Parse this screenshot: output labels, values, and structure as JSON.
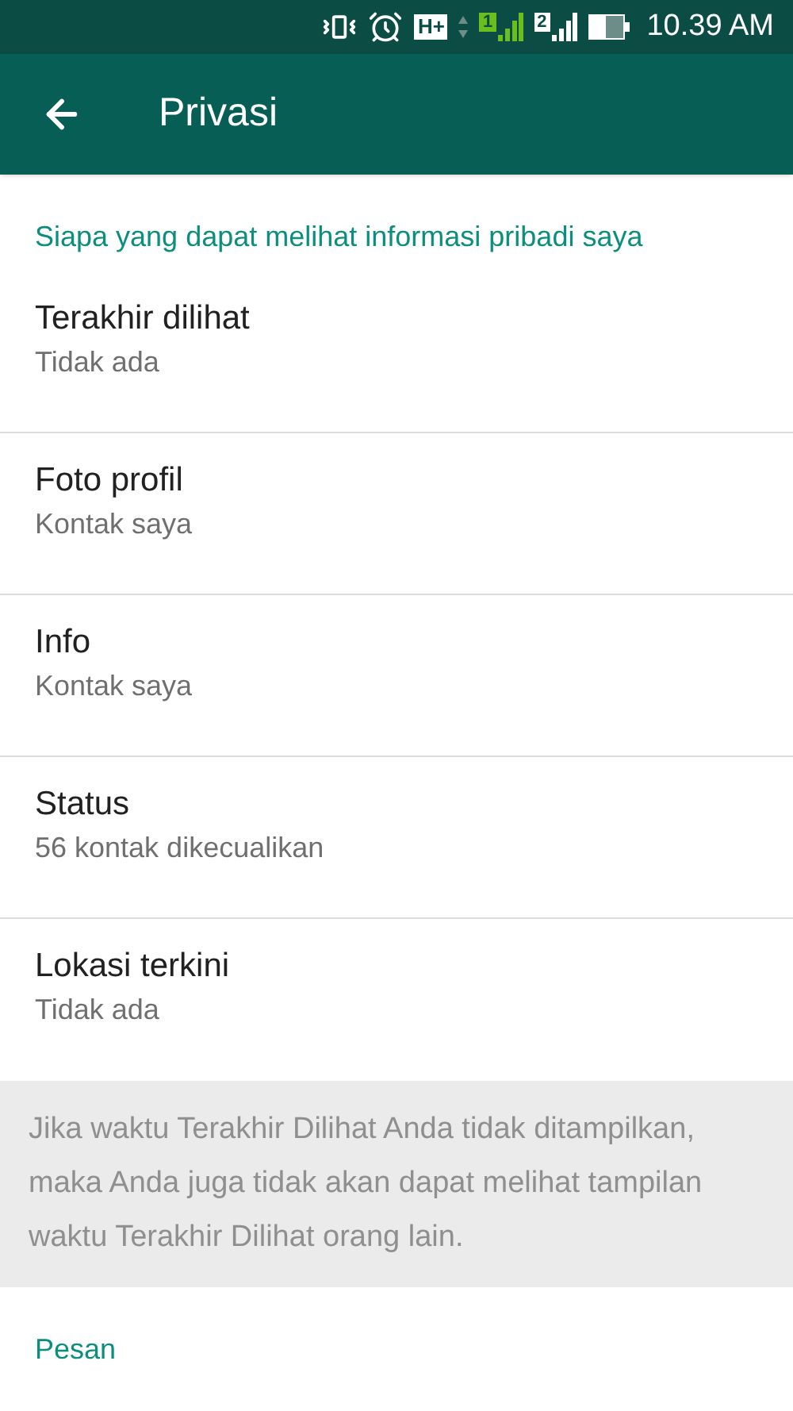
{
  "status_bar": {
    "network": "H+",
    "sim_1": "1",
    "sim_2": "2",
    "time": "10.39 AM"
  },
  "app_bar": {
    "title": "Privasi"
  },
  "section_header": "Siapa yang dapat melihat informasi pribadi saya",
  "settings": [
    {
      "title": "Terakhir dilihat",
      "value": "Tidak ada"
    },
    {
      "title": "Foto profil",
      "value": "Kontak saya"
    },
    {
      "title": "Info",
      "value": "Kontak saya"
    },
    {
      "title": "Status",
      "value": "56 kontak dikecualikan"
    },
    {
      "title": "Lokasi terkini",
      "value": "Tidak ada"
    }
  ],
  "note": "Jika waktu Terakhir Dilihat Anda tidak ditampilkan, maka Anda juga tidak akan dapat melihat tampilan waktu Terakhir Dilihat orang lain.",
  "next_section_header": "Pesan"
}
